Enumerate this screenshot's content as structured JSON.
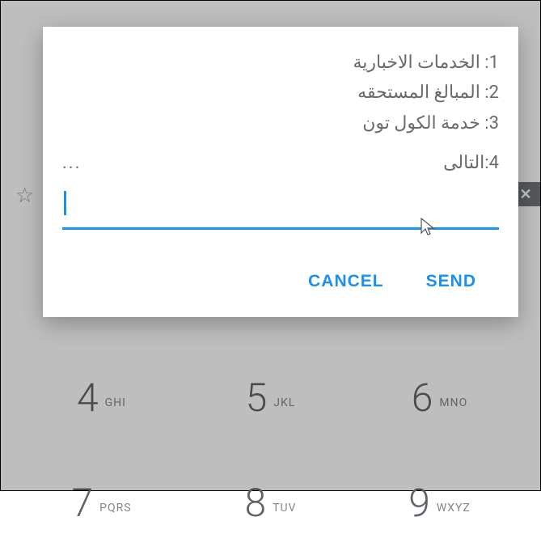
{
  "dialog": {
    "menu_lines": {
      "line1": "1: الخدمات الاخبارية",
      "line2": "2: المبالغ المستحقه",
      "line3": "3: خدمة الكول تون",
      "line4": "4:التالى"
    },
    "truncation": "...",
    "input_value": "",
    "input_placeholder": "",
    "cancel_label": "CANCEL",
    "send_label": "SEND"
  },
  "dialer": {
    "keys": {
      "k4": {
        "digit": "4",
        "letters": "GHI"
      },
      "k5": {
        "digit": "5",
        "letters": "JKL"
      },
      "k6": {
        "digit": "6",
        "letters": "MNO"
      },
      "k7": {
        "digit": "7",
        "letters": "PQRS"
      },
      "k8": {
        "digit": "8",
        "letters": "TUV"
      },
      "k9": {
        "digit": "9",
        "letters": "WXYZ"
      }
    },
    "star_icon": "☆",
    "close_icon": "✕"
  },
  "colors": {
    "accent": "#1a90ef"
  }
}
